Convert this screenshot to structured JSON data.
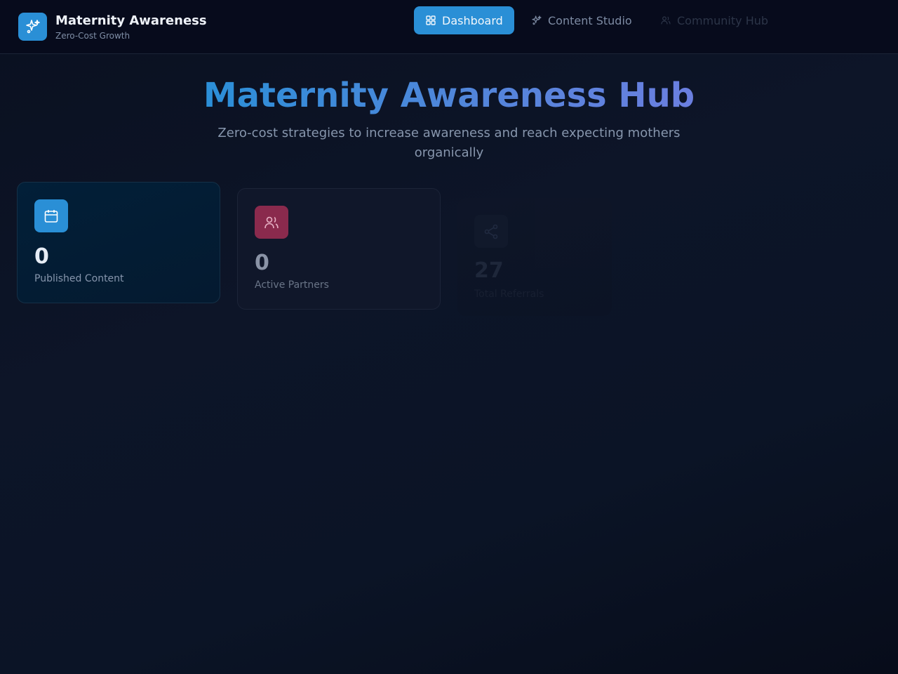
{
  "header": {
    "brand_title": "Maternity Awareness",
    "brand_subtitle": "Zero-Cost Growth",
    "logo_icon": "sparkles-icon",
    "nav": [
      {
        "label": "Dashboard",
        "icon": "grid-icon",
        "active": true
      },
      {
        "label": "Content Studio",
        "icon": "sparkles-icon",
        "active": false
      },
      {
        "label": "Community Hub",
        "icon": "users-icon",
        "active": false
      }
    ]
  },
  "hero": {
    "title": "Maternity Awareness Hub",
    "subtitle": "Zero-cost strategies to increase awareness and reach expecting mothers organically"
  },
  "stats": [
    {
      "value": "0",
      "label": "Published Content",
      "icon": "calendar-icon",
      "color": "#2a8fd6"
    },
    {
      "value": "0",
      "label": "Active Partners",
      "icon": "users-icon",
      "color": "#8a2a4d"
    },
    {
      "value": "27",
      "label": "Total Referrals",
      "icon": "share-icon",
      "color": "#151c2e"
    }
  ],
  "colors": {
    "accent": "#2a8fd6",
    "background": "#0b1222"
  }
}
